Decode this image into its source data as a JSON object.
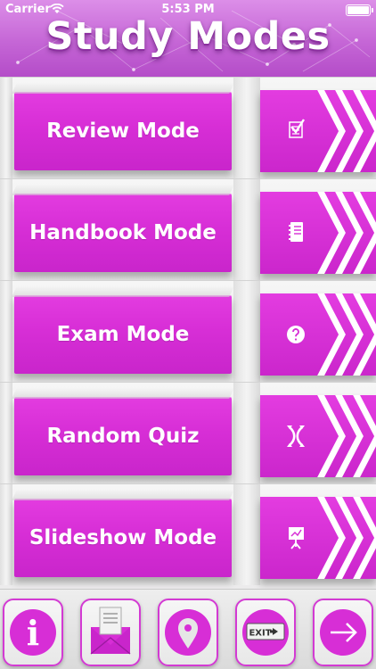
{
  "status_bar": {
    "carrier": "Carrier",
    "time": "5:53 PM"
  },
  "header": {
    "title": "Study Modes"
  },
  "menu": [
    {
      "label": "Review Mode",
      "icon": "checklist-icon"
    },
    {
      "label": "Handbook Mode",
      "icon": "notebook-icon"
    },
    {
      "label": "Exam Mode",
      "icon": "question-icon"
    },
    {
      "label": "Random Quiz",
      "icon": "shuffle-icon"
    },
    {
      "label": "Slideshow Mode",
      "icon": "presentation-icon"
    }
  ],
  "toolbar": [
    {
      "icon": "info-icon",
      "label": "i"
    },
    {
      "icon": "mail-icon"
    },
    {
      "icon": "location-pin-icon"
    },
    {
      "icon": "exit-sign-icon",
      "label": "EXIT"
    },
    {
      "icon": "arrow-right-icon"
    }
  ],
  "colors": {
    "accent": "#d72ed6",
    "header": "#c566d6",
    "background": "#ecebec"
  }
}
